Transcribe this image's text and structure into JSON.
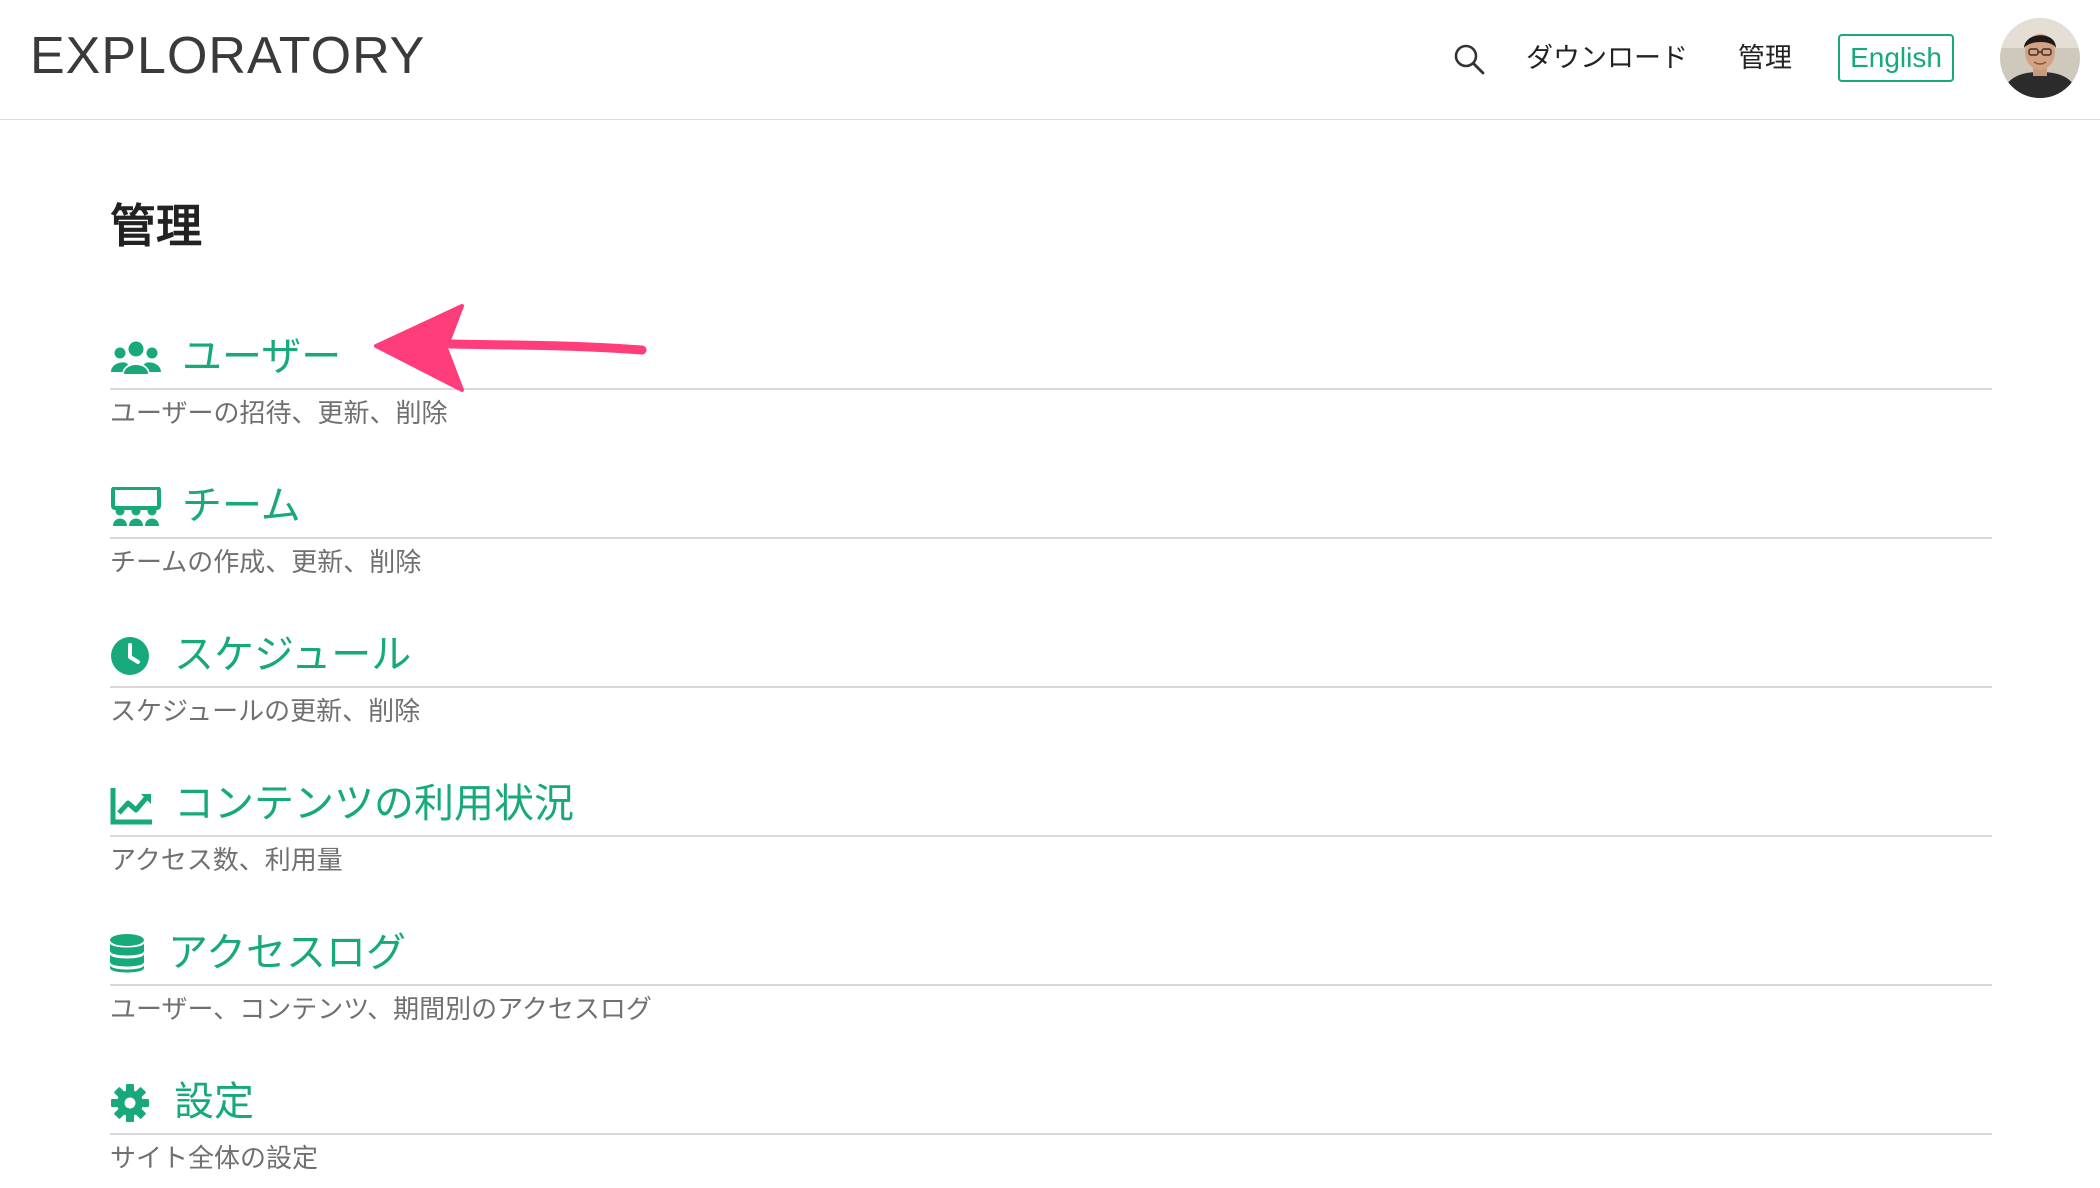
{
  "header": {
    "logo": "EXPLORATORY",
    "search_icon": "search-icon",
    "nav_download": "ダウンロード",
    "nav_admin": "管理",
    "lang_button": "English",
    "avatar_icon": "user-avatar"
  },
  "page": {
    "title": "管理"
  },
  "items": [
    {
      "title": "ユーザー",
      "desc": "ユーザーの招待、更新、削除",
      "icon": "users-icon"
    },
    {
      "title": "チーム",
      "desc": "チームの作成、更新、削除",
      "icon": "team-icon"
    },
    {
      "title": "スケジュール",
      "desc": "スケジュールの更新、削除",
      "icon": "clock-icon"
    },
    {
      "title": "コンテンツの利用状況",
      "desc": "アクセス数、利用量",
      "icon": "chart-line-icon"
    },
    {
      "title": "アクセスログ",
      "desc": "ユーザー、コンテンツ、期間別のアクセスログ",
      "icon": "database-icon"
    },
    {
      "title": "設定",
      "desc": "サイト全体の設定",
      "icon": "gear-icon"
    }
  ],
  "colors": {
    "accent": "#17a97a",
    "annotation_arrow": "#ff3d7a",
    "description_text": "#707070",
    "divider": "#d9d9d9"
  }
}
